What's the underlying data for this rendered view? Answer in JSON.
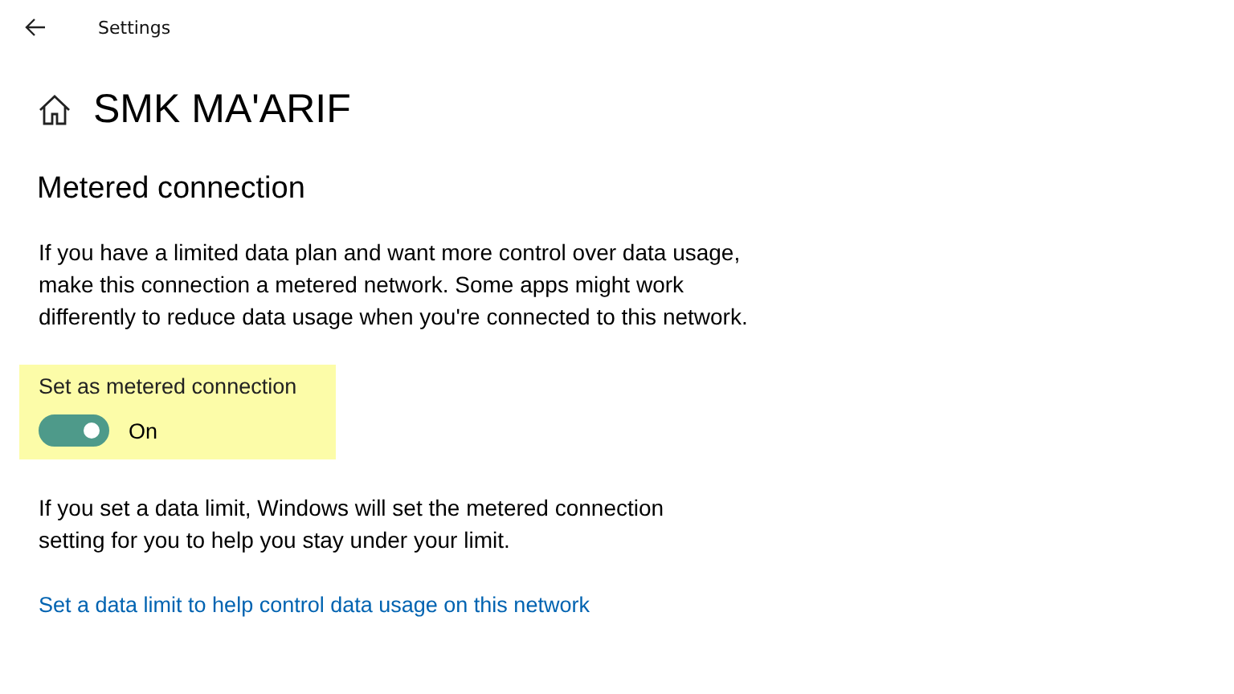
{
  "window": {
    "title": "Settings"
  },
  "page": {
    "title": "SMK MA'ARIF"
  },
  "section": {
    "title": "Metered connection",
    "description": "If you have a limited data plan and want more control over data usage, make this connection a metered network. Some apps might work differently to reduce data usage when you're connected to this network."
  },
  "toggle": {
    "label": "Set as metered connection",
    "on": true,
    "state_text": "On",
    "highlighted": true
  },
  "limit_note": "If you set a data limit, Windows will set the metered connection setting for you to help you stay under your limit.",
  "link": "Set a data limit to help control data usage on this network"
}
